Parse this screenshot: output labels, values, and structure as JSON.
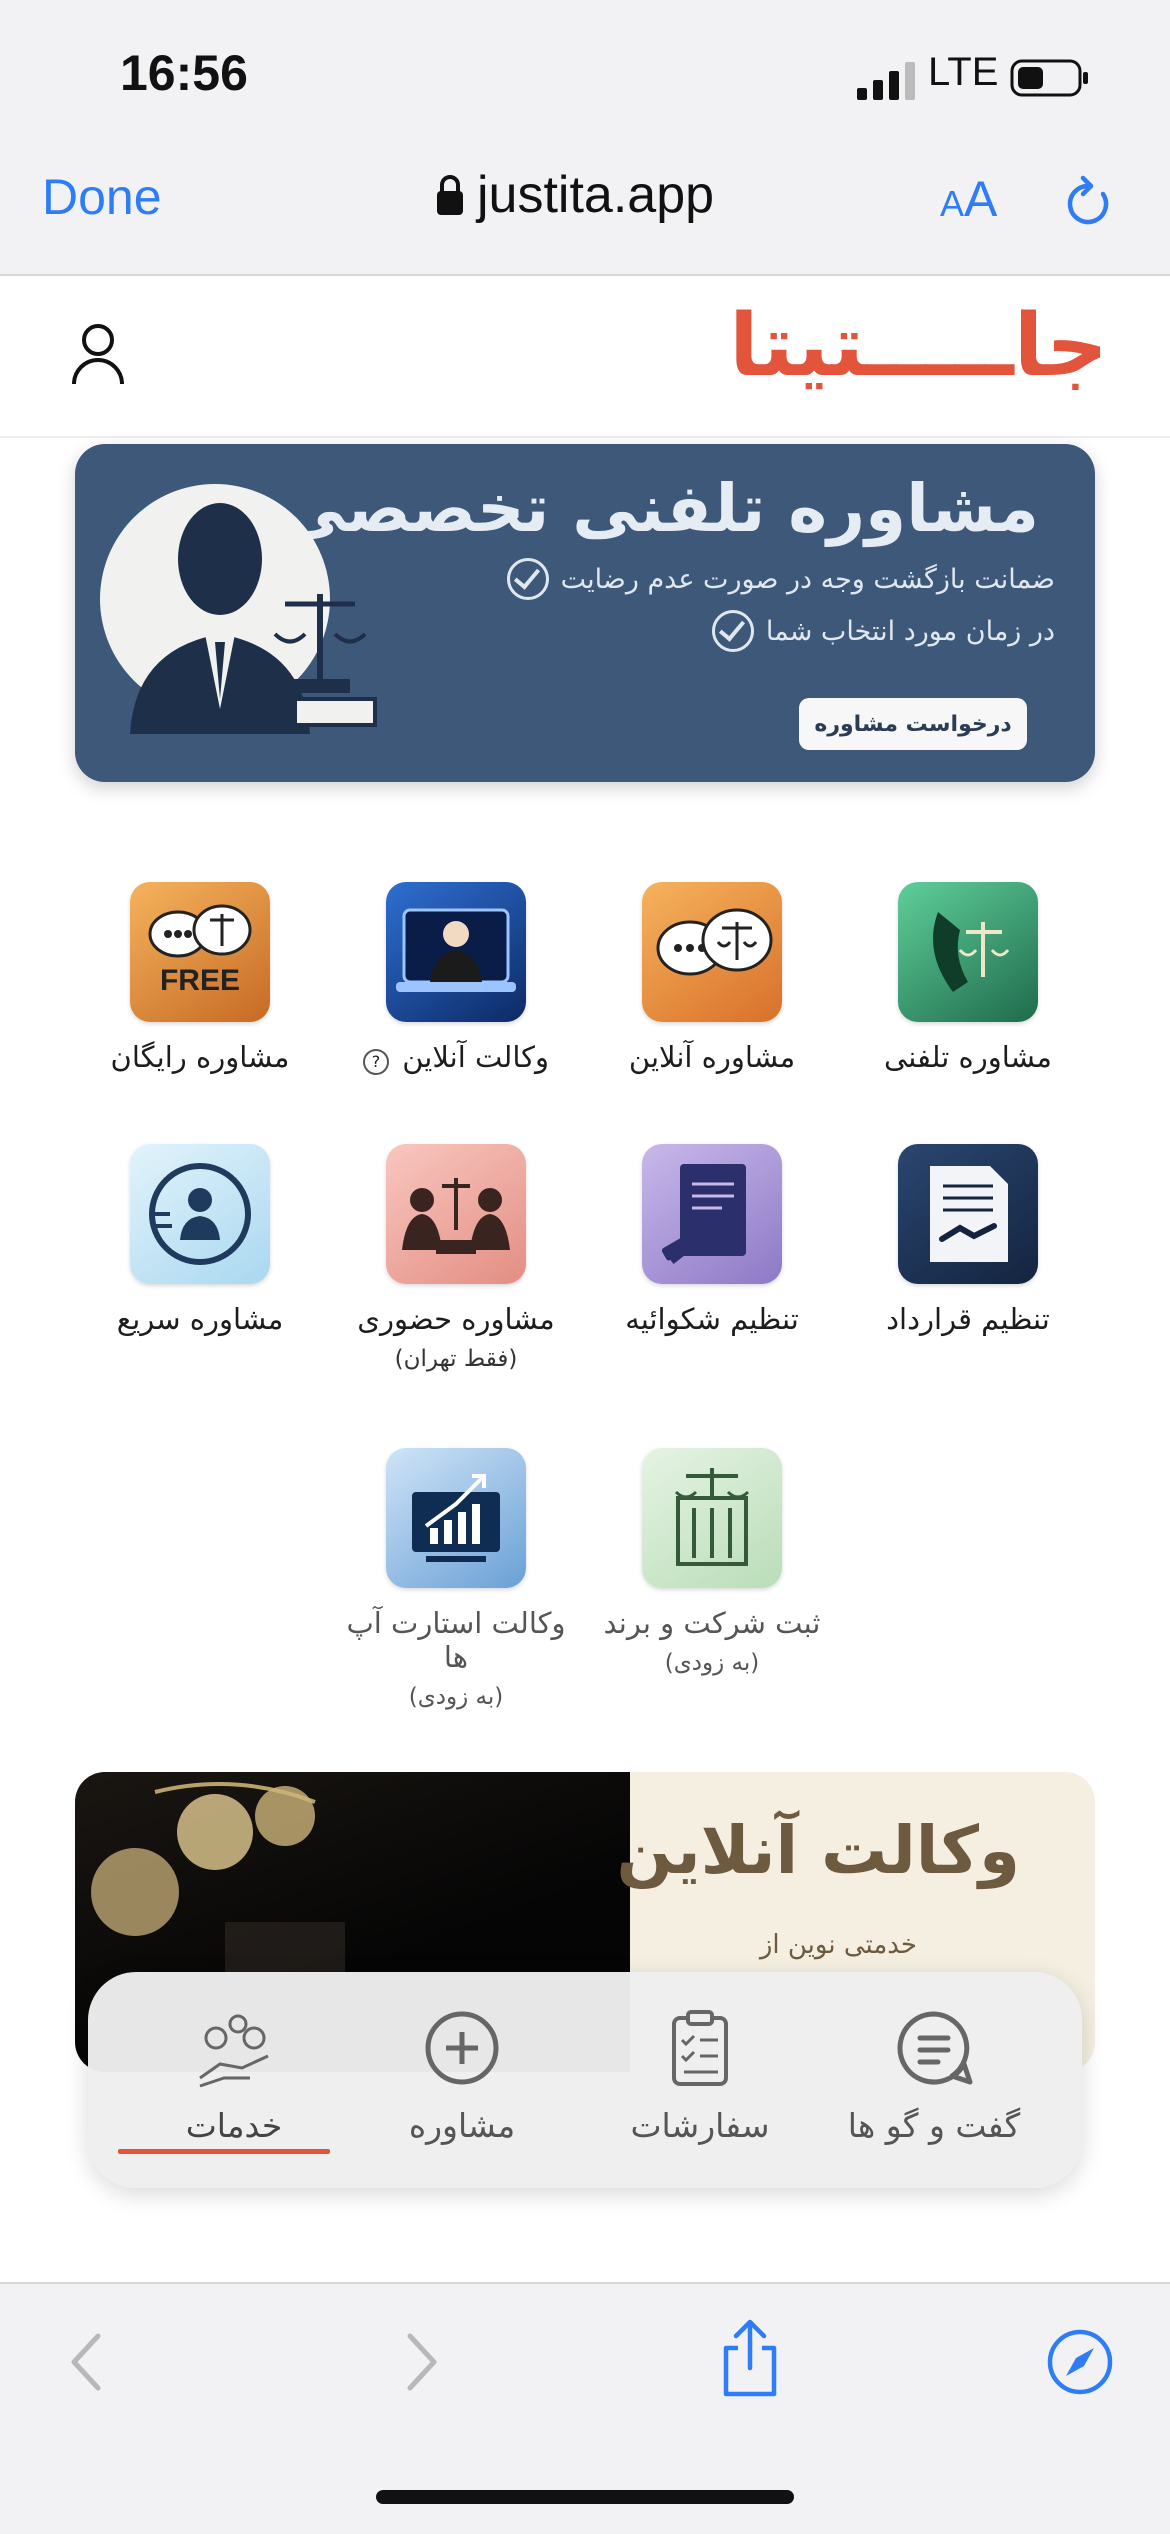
{
  "status_bar": {
    "time": "16:56",
    "network": "LTE"
  },
  "browser": {
    "done_label": "Done",
    "url": "justita.app",
    "text_size_small": "A",
    "text_size_large": "A"
  },
  "site": {
    "logo": "جاـــــتیتا"
  },
  "banner_top": {
    "title": "مشاوره تلفنی تخصصی",
    "feature_1": "ضمانت بازگشت وجه در صورت عدم رضایت",
    "feature_2": "در زمان مورد انتخاب شما",
    "cta": "درخواست مشاوره"
  },
  "services": [
    {
      "label": "مشاوره تلفنی",
      "sub": ""
    },
    {
      "label": "مشاوره آنلاین",
      "sub": ""
    },
    {
      "label": "وکالت آنلاین",
      "sub": ""
    },
    {
      "label": "مشاوره رایگان",
      "sub": "",
      "badge": "FREE"
    },
    {
      "label": "تنظیم قرارداد",
      "sub": ""
    },
    {
      "label": "تنظیم شکوائیه",
      "sub": ""
    },
    {
      "label": "مشاوره حضوری",
      "sub": "(فقط تهران)"
    },
    {
      "label": "مشاوره سریع",
      "sub": ""
    },
    {
      "label": "ثبت شرکت و برند",
      "sub": "(به زودی)"
    },
    {
      "label": "وکالت استارت آپ ها",
      "sub": "(به زودی)"
    }
  ],
  "banner_bottom": {
    "title": "وکالت آنلاین",
    "subtitle": "خدمتی نوین از"
  },
  "tab_bar": {
    "tabs": [
      {
        "label": "خدمات",
        "icon": "services-icon",
        "active": true
      },
      {
        "label": "مشاوره",
        "icon": "plus-circle-icon",
        "active": false
      },
      {
        "label": "سفارشات",
        "icon": "clipboard-list-icon",
        "active": false
      },
      {
        "label": "گفت و گو ها",
        "icon": "chat-icon",
        "active": false
      }
    ]
  },
  "colors": {
    "accent": "#e2543b",
    "ios_blue": "#2f7df6",
    "banner_bg": "#3d5879"
  }
}
